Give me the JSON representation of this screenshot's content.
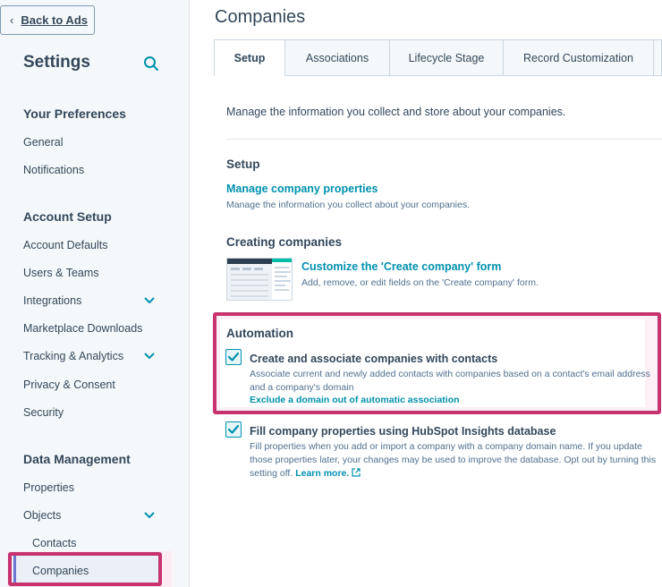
{
  "sidebar": {
    "back_label": "Back to Ads",
    "title": "Settings",
    "sections": [
      {
        "heading": "Your Preferences",
        "items": [
          "General",
          "Notifications"
        ]
      },
      {
        "heading": "Account Setup",
        "items": [
          "Account Defaults",
          "Users & Teams",
          "Integrations",
          "Marketplace Downloads",
          "Tracking & Analytics",
          "Privacy & Consent",
          "Security"
        ]
      },
      {
        "heading": "Data Management",
        "items": [
          "Properties",
          "Objects"
        ]
      }
    ],
    "objects_children": [
      "Contacts",
      "Companies"
    ]
  },
  "main": {
    "title": "Companies",
    "tabs": [
      "Setup",
      "Associations",
      "Lifecycle Stage",
      "Record Customization"
    ],
    "intro": "Manage the information you collect and store about your companies.",
    "setup": {
      "heading": "Setup",
      "link": "Manage company properties",
      "desc": "Manage the information you collect about your companies."
    },
    "creating": {
      "heading": "Creating companies",
      "link": "Customize the 'Create company' form",
      "desc": "Add, remove, or edit fields on the 'Create company' form."
    },
    "automation": {
      "heading": "Automation",
      "option1_title": "Create and associate companies with contacts",
      "option1_desc": "Associate current and newly added contacts with companies based on a contact's email address and a company's domain",
      "option1_link": "Exclude a domain out of automatic association",
      "option2_title": "Fill company properties using HubSpot Insights database",
      "option2_desc": "Fill properties when you add or import a company with a company domain name. If you update those properties later, your changes may be used to improve the database. Opt out by turning this setting off.",
      "option2_link": "Learn more."
    }
  },
  "colors": {
    "accent": "#0091ae",
    "highlight": "#c7336e",
    "text": "#33475b"
  },
  "icons": {
    "back": "chevron-left-icon",
    "search": "search-icon",
    "expand": "chevron-down-icon",
    "check": "check-icon",
    "external": "external-link-icon"
  }
}
